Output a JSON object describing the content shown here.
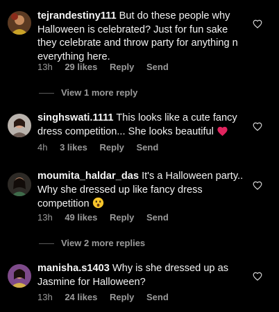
{
  "comments": [
    {
      "username": "tejrandestiny111",
      "text": "But do these people why Halloween is celebrated? Just for fun sake they celebrate and throw party for anything n everything here.",
      "time": "13h",
      "likes": "29 likes",
      "reply": "Reply",
      "send": "Send",
      "view_more": "View 1 more reply"
    },
    {
      "username": "singhswati.1111",
      "text": "This looks like a cute fancy dress competition... She looks beautiful",
      "emoji": "red-heart",
      "time": "4h",
      "likes": "3 likes",
      "reply": "Reply",
      "send": "Send"
    },
    {
      "username": "moumita_haldar_das",
      "text": "It's a Halloween party.. Why she dressed up like fancy dress competition",
      "emoji": "astonished-face",
      "time": "13h",
      "likes": "49 likes",
      "reply": "Reply",
      "send": "Send",
      "view_more": "View 2 more replies"
    },
    {
      "username": "manisha.s1403",
      "text": "Why is she dressed up as Jasmine for Halloween?",
      "time": "13h",
      "likes": "24 likes",
      "reply": "Reply",
      "send": "Send"
    }
  ],
  "colors": {
    "background": "#000000",
    "text": "#f2f2f2",
    "muted": "#9b9b9b",
    "heart_emoji": "#e0245e"
  }
}
